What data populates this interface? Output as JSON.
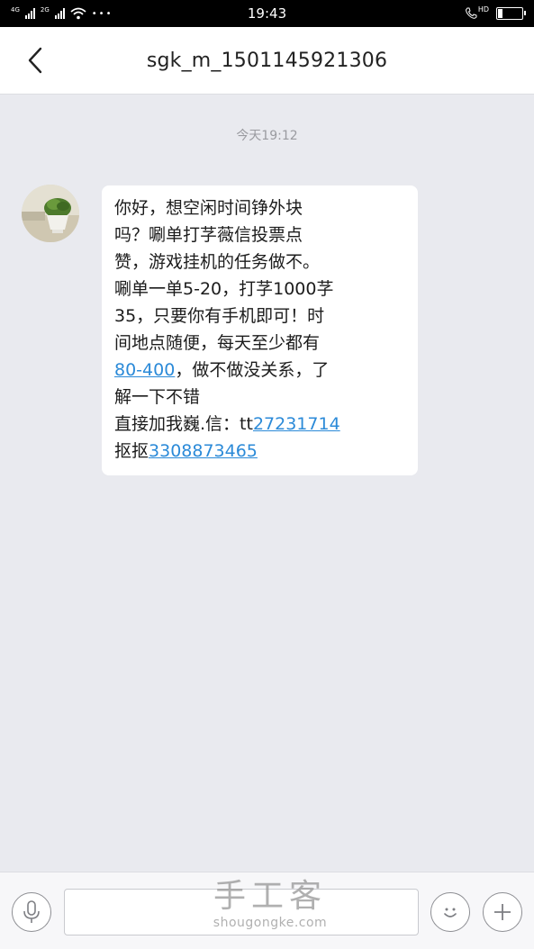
{
  "status_bar": {
    "network_1": "4G",
    "network_2": "2G",
    "time": "19:43",
    "hd": "HD",
    "battery_level": 0.2
  },
  "header": {
    "title": "sgk_m_1501145921306",
    "back_icon": "chevron-left-icon"
  },
  "chat": {
    "timestamp": "今天19:12",
    "message": {
      "line1": "你好，想空闲时间铮外块",
      "line2": "吗？唰单打芓薇信投票点",
      "line3": "赞，游戏挂机的任务做不。",
      "line4": "唰单一单5-20，打芓1000芓",
      "line5": "35，只要你有手机即可！时",
      "line6": "间地点随便，每天至少都有",
      "line7_link": "80-400",
      "line7_rest": "，做不做没关系，了",
      "line8": "解一下不错",
      "line9_prefix": "直接加我巍.信：tt",
      "line9_link": "27231714",
      "line10_prefix": "抠抠",
      "line10_link": "3308873465"
    }
  },
  "input_bar": {
    "mic_icon": "microphone-icon",
    "emoji_icon": "smiley-icon",
    "plus_icon": "plus-icon",
    "input_value": ""
  },
  "watermark": {
    "title": "手工客",
    "subtitle": "shougongke.com"
  },
  "colors": {
    "background": "#e9eaef",
    "link": "#2b8ad8",
    "bubble": "#ffffff"
  }
}
